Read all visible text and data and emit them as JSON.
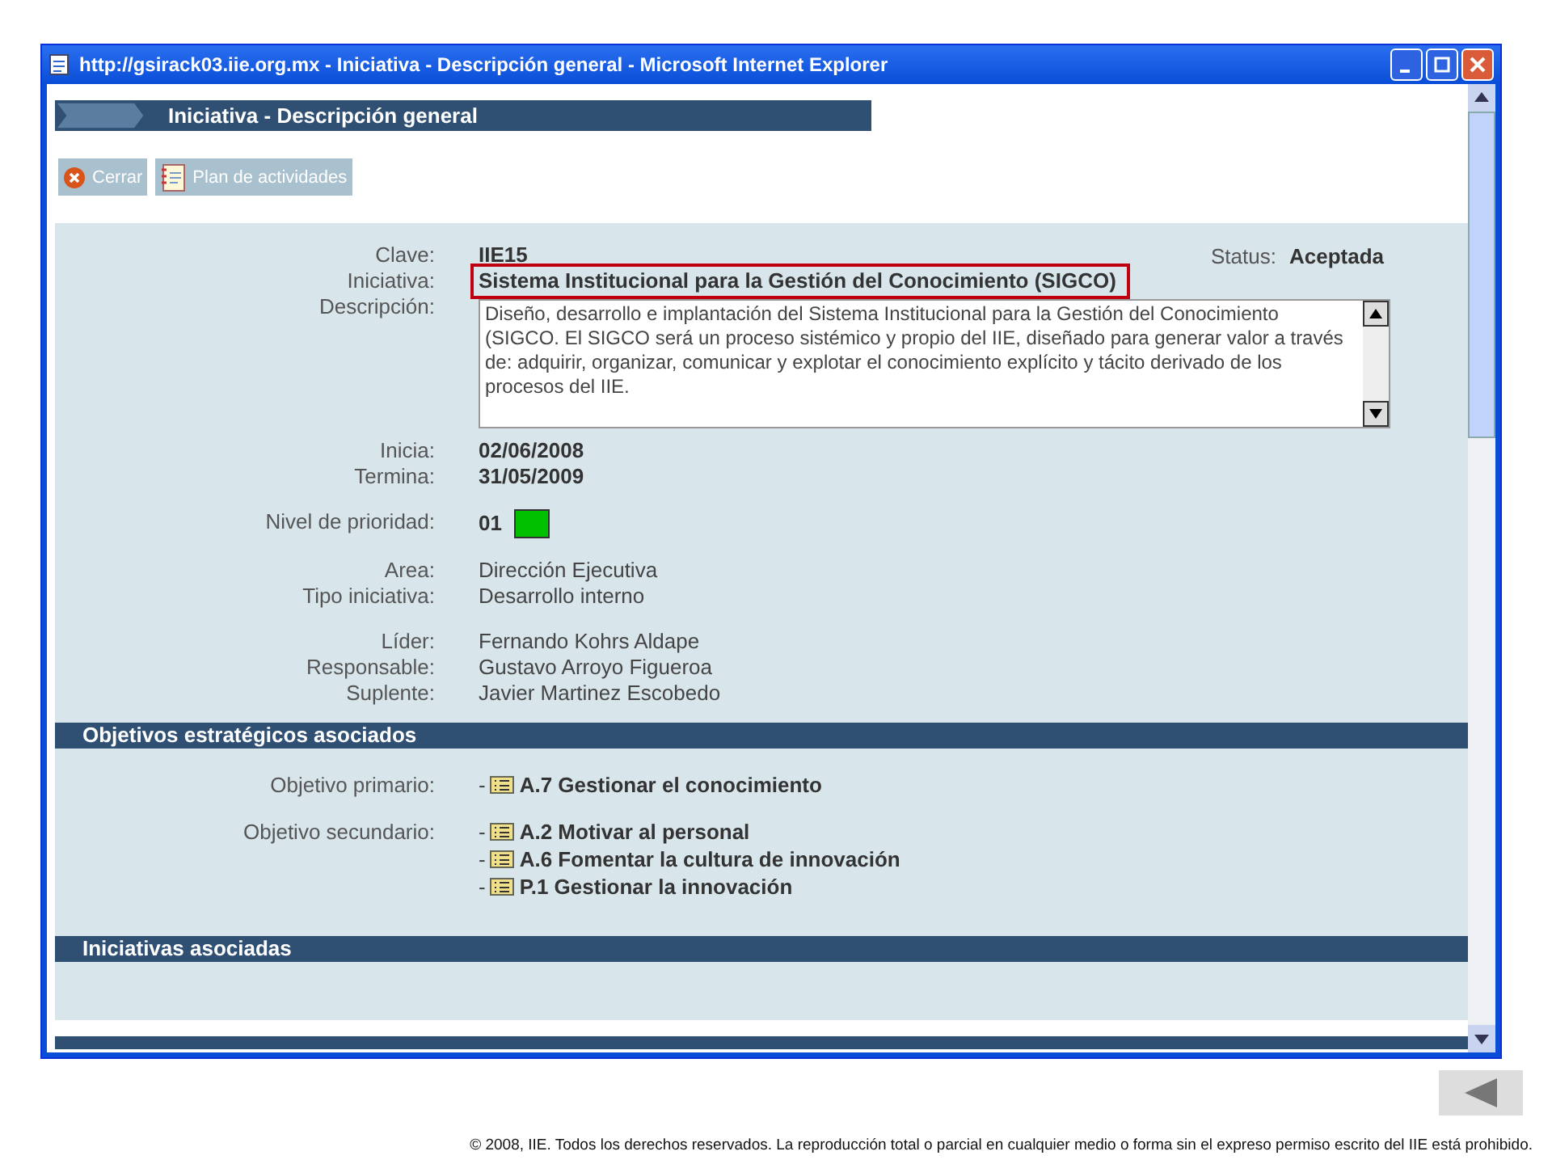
{
  "window": {
    "title": "http://gsirack03.iie.org.mx - Iniciativa - Descripción general - Microsoft Internet Explorer"
  },
  "page_title": "Iniciativa - Descripción general",
  "toolbar": [
    {
      "kind": "close",
      "label": "Cerrar"
    },
    {
      "kind": "plan",
      "label": "Plan de actividades"
    }
  ],
  "status": {
    "label": "Status:",
    "value": "Aceptada"
  },
  "groups": [
    [
      {
        "label": "Clave:",
        "value": "IIE15",
        "kind": "bold"
      },
      {
        "label": "Iniciativa:",
        "value": "Sistema Institucional para la Gestión del Conocimiento (SIGCO)",
        "kind": "highlight"
      },
      {
        "label": "Descripción:",
        "value": "Diseño, desarrollo e implantación del Sistema Institucional para la Gestión del Conocimiento (SIGCO. El SIGCO será un proceso sistémico y propio del IIE, diseñado para generar valor a través de: adquirir, organizar, comunicar y explotar el conocimiento explícito y tácito derivado de los procesos del IIE.",
        "kind": "textarea"
      },
      {
        "label": "Inicia:",
        "value": "02/06/2008",
        "kind": "bold"
      },
      {
        "label": "Termina:",
        "value": "31/05/2009",
        "kind": "bold"
      }
    ],
    [
      {
        "label": "Nivel de prioridad:",
        "value": "01",
        "kind": "priority",
        "color": "#00c000"
      }
    ],
    [
      {
        "label": "Area:",
        "value": "Dirección Ejecutiva",
        "kind": "plain"
      },
      {
        "label": "Tipo iniciativa:",
        "value": "Desarrollo interno",
        "kind": "plain"
      }
    ],
    [
      {
        "label": "Líder:",
        "value": "Fernando Kohrs Aldape",
        "kind": "plain"
      },
      {
        "label": "Responsable:",
        "value": "Gustavo Arroyo Figueroa",
        "kind": "plain"
      },
      {
        "label": "Suplente:",
        "value": "Javier Martinez Escobedo",
        "kind": "plain"
      }
    ]
  ],
  "objectives_section": {
    "title": "Objetivos estratégicos asociados",
    "rows": [
      {
        "label": "Objetivo primario:",
        "items": [
          {
            "marker": "-",
            "text": "A.7 Gestionar el conocimiento"
          }
        ]
      },
      {
        "label": "Objetivo secundario:",
        "items": [
          {
            "marker": "-",
            "text": "A.2 Motivar al personal"
          },
          {
            "marker": "-",
            "text": "A.6 Fomentar la cultura de innovación"
          },
          {
            "marker": "-",
            "text": "P.1 Gestionar la innovación"
          }
        ]
      }
    ]
  },
  "related_section": {
    "title": "Iniciativas asociadas"
  },
  "footer": "© 2008, IIE. Todos los derechos reservados. La reproducción total o parcial en cualquier medio o forma sin el expreso permiso escrito del IIE está prohibido."
}
